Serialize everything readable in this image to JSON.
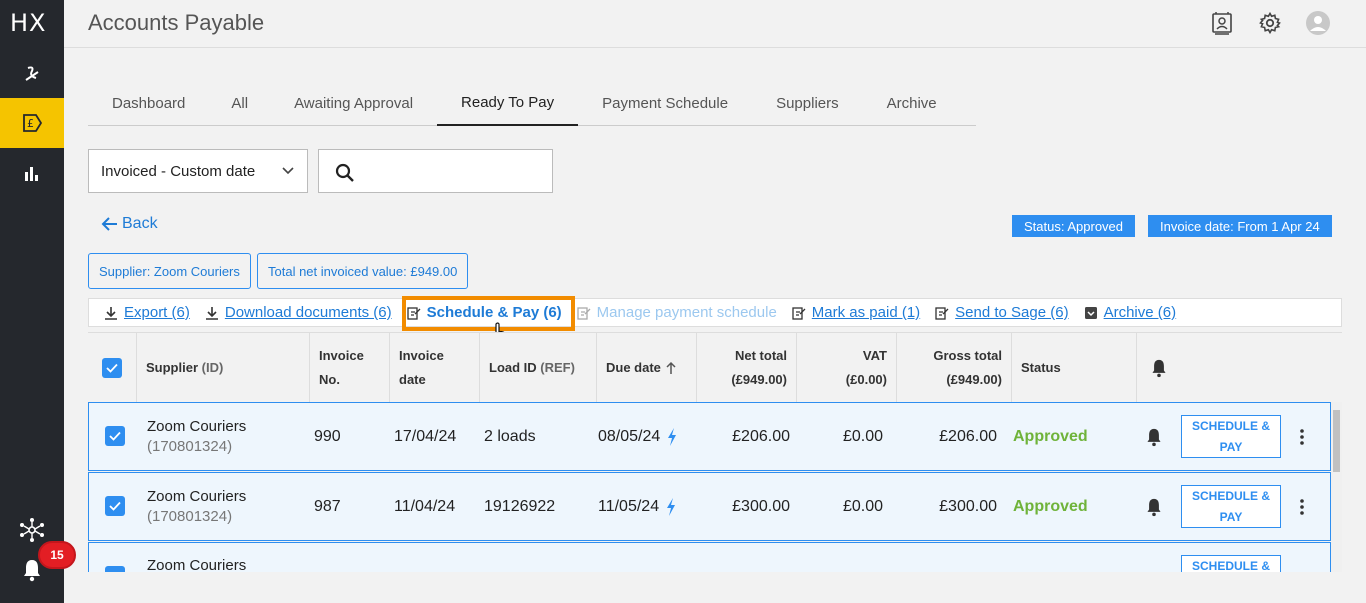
{
  "app": {
    "logo": "HX",
    "title": "Accounts Payable"
  },
  "sidebar": {
    "notification_count": "15"
  },
  "tabs": [
    {
      "label": "Dashboard"
    },
    {
      "label": "All"
    },
    {
      "label": "Awaiting Approval"
    },
    {
      "label": "Ready To Pay",
      "active": true
    },
    {
      "label": "Payment Schedule"
    },
    {
      "label": "Suppliers"
    },
    {
      "label": "Archive"
    }
  ],
  "filters": {
    "date_select": "Invoiced - Custom date",
    "search_value": "",
    "back_label": "Back",
    "status_chip": "Status: Approved",
    "date_chip": "Invoice date: From 1 Apr 24",
    "supplier_chip": "Supplier: Zoom Couriers",
    "total_chip": "Total net invoiced value: £949.00"
  },
  "actions": {
    "export": "Export (6)",
    "download": "Download documents (6)",
    "schedule_pay": "Schedule & Pay (6)",
    "manage_schedule": "Manage payment schedule",
    "mark_paid": "Mark as paid (1)",
    "send_sage": "Send to Sage (6)",
    "archive": "Archive (6)"
  },
  "table": {
    "headers": {
      "supplier": "Supplier",
      "supplier_sub": "(ID)",
      "invoice_no_1": "Invoice",
      "invoice_no_2": "No.",
      "invoice_date_1": "Invoice",
      "invoice_date_2": "date",
      "load_id": "Load ID",
      "load_id_sub": "(REF)",
      "due_date": "Due date",
      "net_total_1": "Net total",
      "net_total_2": "(£949.00)",
      "vat_1": "VAT",
      "vat_2": "(£0.00)",
      "gross_total_1": "Gross total",
      "gross_total_2": "(£949.00)",
      "status": "Status"
    },
    "rows": [
      {
        "supplier": "Zoom Couriers",
        "supplier_id": "(170801324)",
        "invoice_no": "990",
        "invoice_date": "17/04/24",
        "load_id": "2 loads",
        "due_date": "08/05/24",
        "net": "£206.00",
        "vat": "£0.00",
        "gross": "£206.00",
        "status": "Approved",
        "button": "SCHEDULE & PAY"
      },
      {
        "supplier": "Zoom Couriers",
        "supplier_id": "(170801324)",
        "invoice_no": "987",
        "invoice_date": "11/04/24",
        "load_id": "19126922",
        "due_date": "11/05/24",
        "net": "£300.00",
        "vat": "£0.00",
        "gross": "£300.00",
        "status": "Approved",
        "button": "SCHEDULE & PAY"
      },
      {
        "supplier": "Zoom Couriers",
        "supplier_id": "",
        "invoice_no": "",
        "invoice_date": "",
        "load_id": "",
        "due_date": "",
        "net": "",
        "vat": "",
        "gross": "",
        "status": "",
        "button": "SCHEDULE &"
      }
    ]
  },
  "colors": {
    "accent": "#2e8ef0",
    "sidebar_active": "#f5c400",
    "approved": "#6fb33a",
    "highlight": "#f28c00"
  }
}
